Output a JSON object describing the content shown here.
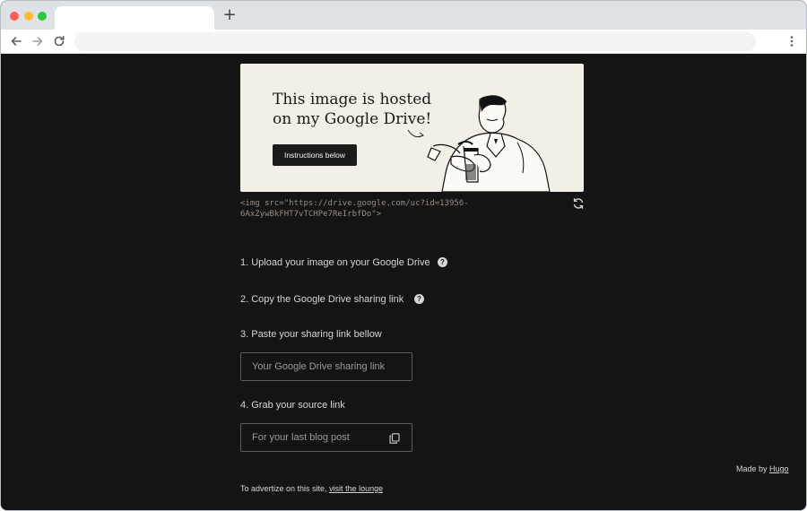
{
  "browser": {
    "icons": {
      "back": "arrow-left-icon",
      "forward": "arrow-right-icon",
      "reload": "reload-icon",
      "menu": "vertical-dots-icon",
      "new_tab": "+"
    },
    "traffic_light_colors": [
      "#ff5f57",
      "#febc2e",
      "#28c840"
    ]
  },
  "hero": {
    "title": "This image is hosted on my Google Drive!",
    "button_label": "Instructions below"
  },
  "snippet": {
    "line1": "<img src=\"https://drive.google.com/uc?id=13956-",
    "line2": "6AxZywBkFHT7vTCHPe7ReIrbfDo\">"
  },
  "steps": {
    "step1": "1. Upload your image on your Google Drive",
    "step2": "2. Copy the Google Drive sharing link",
    "step3": "3. Paste your sharing link bellow",
    "step4": "4. Grab your source link",
    "help_glyph": "?"
  },
  "inputs": {
    "share_placeholder": "Your Google Drive sharing link",
    "source_placeholder": "For your last blog post"
  },
  "footer": {
    "made_by_prefix": "Made by ",
    "made_by_link": "Hugo",
    "advert_prefix": "To advertize on this site, ",
    "advert_link": "visit the lounge"
  },
  "colors": {
    "page_background": "#141414",
    "hero_background": "#f1efe6",
    "text": "#d6d6d6"
  }
}
